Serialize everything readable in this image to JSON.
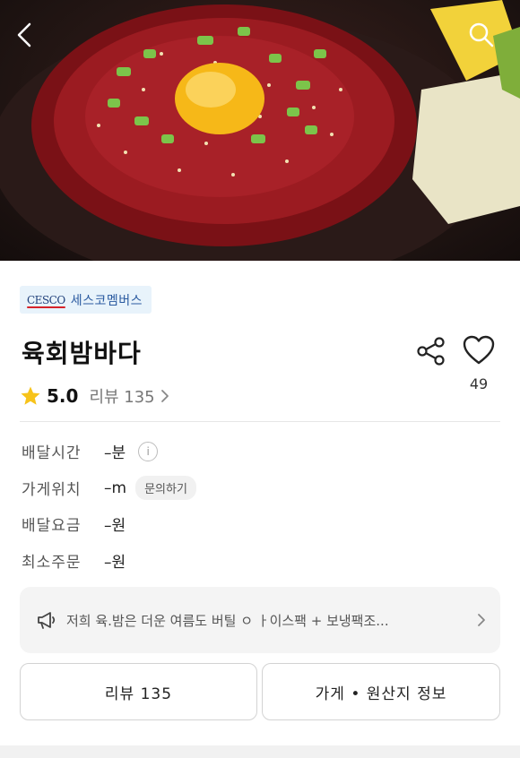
{
  "hero": {
    "back_icon": "chevron-left-icon",
    "search_icon": "search-icon"
  },
  "brand": {
    "logo": "CESCO",
    "name": "세스코멤버스"
  },
  "store": {
    "title": "육회밤바다",
    "rating": "5.0",
    "review_label": "리뷰 135",
    "like_count": "49"
  },
  "info": {
    "delivery_time": {
      "label": "배달시간",
      "value": "–분"
    },
    "location": {
      "label": "가게위치",
      "value": "–m",
      "action": "문의하기"
    },
    "delivery_fee": {
      "label": "배달요금",
      "value": "–원"
    },
    "min_order": {
      "label": "최소주문",
      "value": "–원"
    }
  },
  "notice": {
    "text": "저희 육.밤은 더운 여름도 버틸 ㅇ ㅏ이스팩 + 보냉팩조..."
  },
  "buttons": {
    "review": "리뷰 135",
    "origin": "가게 • 원산지 정보"
  },
  "colors": {
    "star": "#f7c31a",
    "badge_bg": "#e8f3fb",
    "brand_text": "#2a5aa0"
  }
}
